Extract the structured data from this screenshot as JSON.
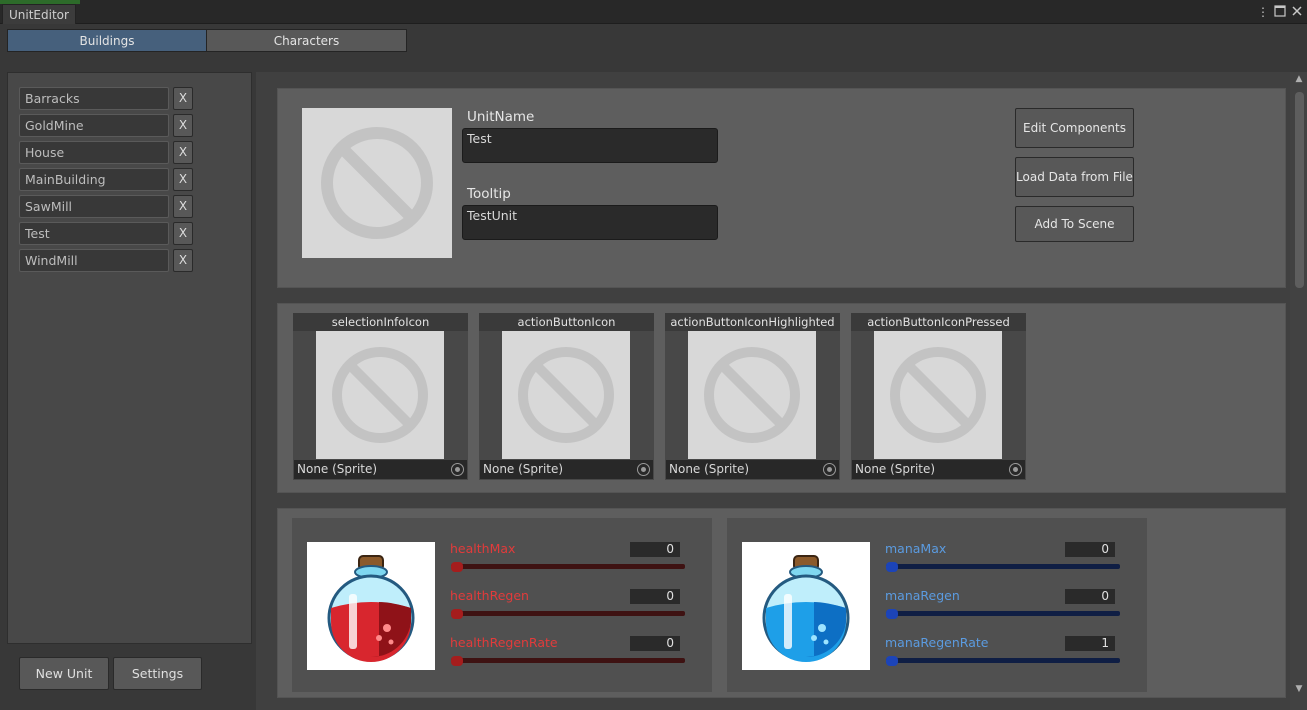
{
  "window": {
    "title": "UnitEditor"
  },
  "tabs": [
    {
      "label": "Buildings",
      "active": true
    },
    {
      "label": "Characters",
      "active": false
    }
  ],
  "unit_list": [
    {
      "name": "Barracks",
      "remove_label": "X"
    },
    {
      "name": "GoldMine",
      "remove_label": "X"
    },
    {
      "name": "House",
      "remove_label": "X"
    },
    {
      "name": "MainBuilding",
      "remove_label": "X"
    },
    {
      "name": "SawMill",
      "remove_label": "X"
    },
    {
      "name": "Test",
      "remove_label": "X"
    },
    {
      "name": "WindMill",
      "remove_label": "X"
    }
  ],
  "left_buttons": {
    "new_unit": "New Unit",
    "settings": "Settings"
  },
  "details": {
    "unit_name_label": "UnitName",
    "unit_name_value": "Test",
    "tooltip_label": "Tooltip",
    "tooltip_value": "TestUnit"
  },
  "actions": {
    "edit_components": "Edit Components",
    "load_data": "Load Data from File",
    "add_to_scene": "Add To Scene"
  },
  "sprites": [
    {
      "label": "selectionInfoIcon",
      "value": "None (Sprite)"
    },
    {
      "label": "actionButtonIcon",
      "value": "None (Sprite)"
    },
    {
      "label": "actionButtonIconHighlighted",
      "value": "None (Sprite)"
    },
    {
      "label": "actionButtonIconPressed",
      "value": "None (Sprite)"
    }
  ],
  "health_stats": [
    {
      "label": "healthMax",
      "value": "0"
    },
    {
      "label": "healthRegen",
      "value": "0"
    },
    {
      "label": "healthRegenRate",
      "value": "0"
    }
  ],
  "mana_stats": [
    {
      "label": "manaMax",
      "value": "0"
    },
    {
      "label": "manaRegen",
      "value": "0"
    },
    {
      "label": "manaRegenRate",
      "value": "1"
    }
  ],
  "colors": {
    "tab_active": "#46607c",
    "health": "#e23b3b",
    "health_track": "#3e1212",
    "mana": "#5b9be0",
    "mana_track": "#0f1e44"
  },
  "icons": [
    "none-placeholder-icon",
    "object-picker-icon",
    "red-potion-icon",
    "blue-potion-icon",
    "window-menu-icon",
    "maximize-icon",
    "close-icon"
  ]
}
